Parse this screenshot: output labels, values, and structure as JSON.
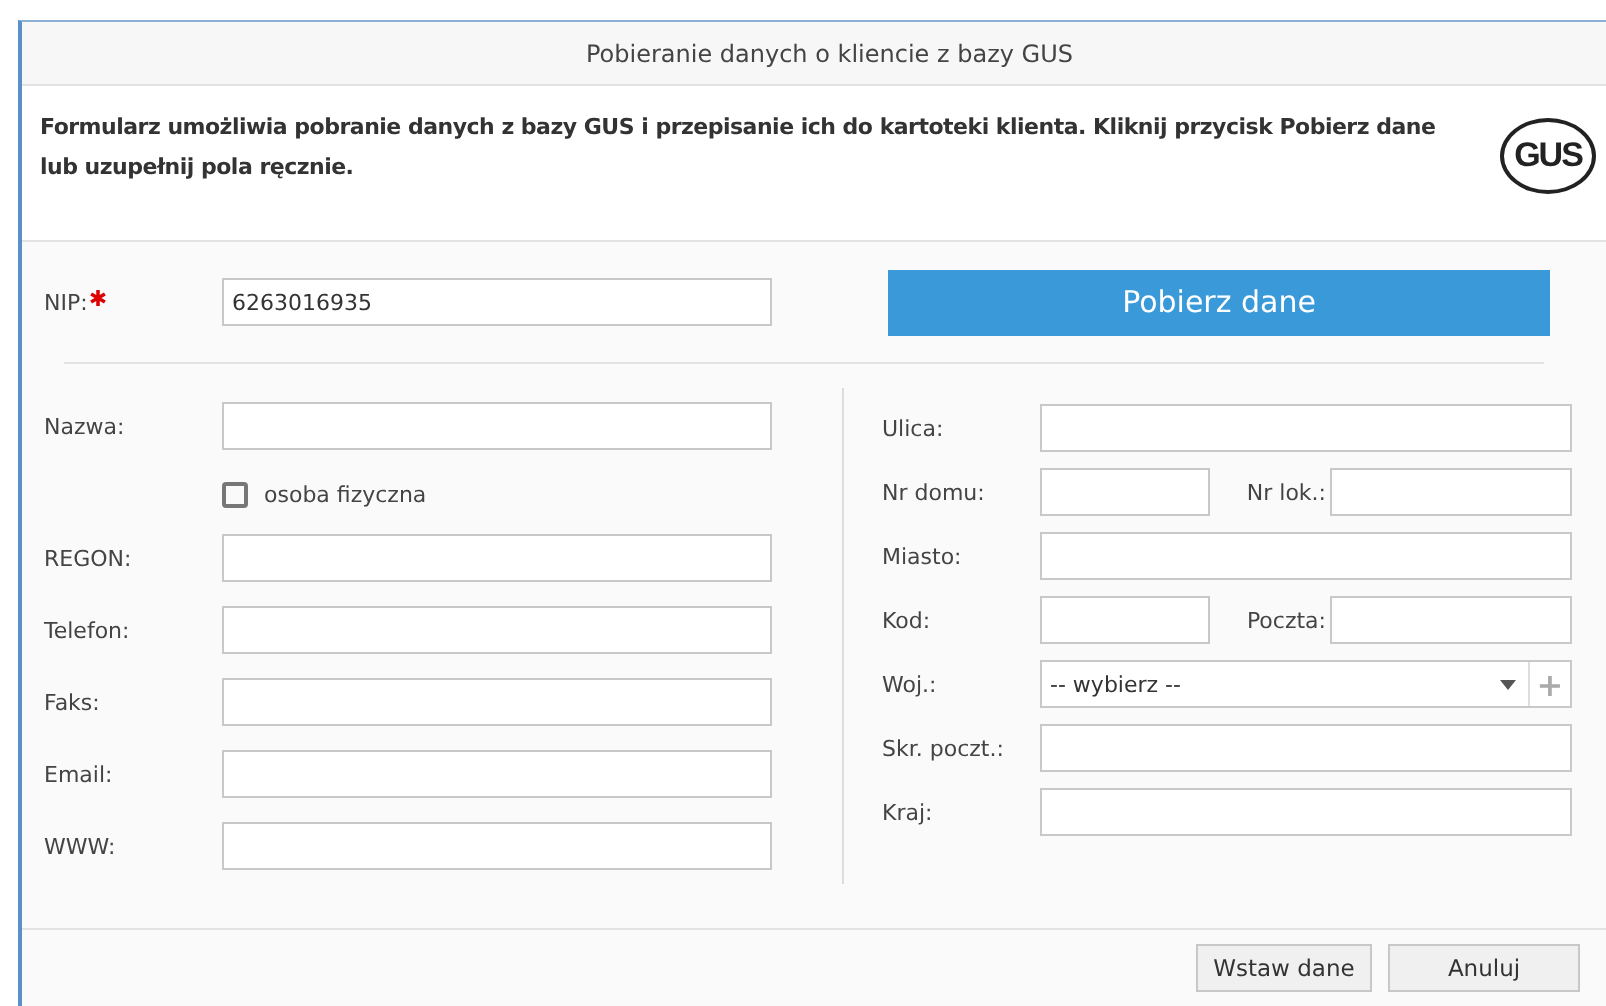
{
  "window": {
    "title": "Pobieranie danych o kliencie z bazy GUS"
  },
  "intro": {
    "text": "Formularz umożliwia pobranie danych z bazy GUS i przepisanie ich do kartoteki klienta. Kliknij przycisk Pobierz dane lub uzupełnij pola ręcznie.",
    "logo": "GUS"
  },
  "nip": {
    "label": "NIP:",
    "required": true,
    "value": "6263016935"
  },
  "fetch_button": "Pobierz dane",
  "left_rows": [
    {
      "kind": "field",
      "label": "Nazwa:"
    },
    {
      "kind": "checkbox",
      "label": "osoba fizyczna",
      "checked": false
    },
    {
      "kind": "field",
      "label": "REGON:"
    },
    {
      "kind": "field",
      "label": "Telefon:"
    },
    {
      "kind": "field",
      "label": "Faks:"
    },
    {
      "kind": "field",
      "label": "Email:"
    },
    {
      "kind": "field",
      "label": "WWW:"
    }
  ],
  "right_rows": [
    {
      "kind": "field",
      "label": "Ulica:"
    },
    {
      "kind": "pair",
      "label": "Nr domu:",
      "label_2": "Nr lok.:"
    },
    {
      "kind": "field",
      "label": "Miasto:"
    },
    {
      "kind": "pair",
      "label": "Kod:",
      "label_2": "Poczta:"
    },
    {
      "kind": "select",
      "label": "Woj.:",
      "value": "-- wybierz --",
      "add": "+"
    },
    {
      "kind": "field",
      "label": "Skr. poczt.:"
    },
    {
      "kind": "field",
      "label": "Kraj:"
    }
  ],
  "buttons": [
    "Wstaw dane",
    "Anuluj"
  ]
}
